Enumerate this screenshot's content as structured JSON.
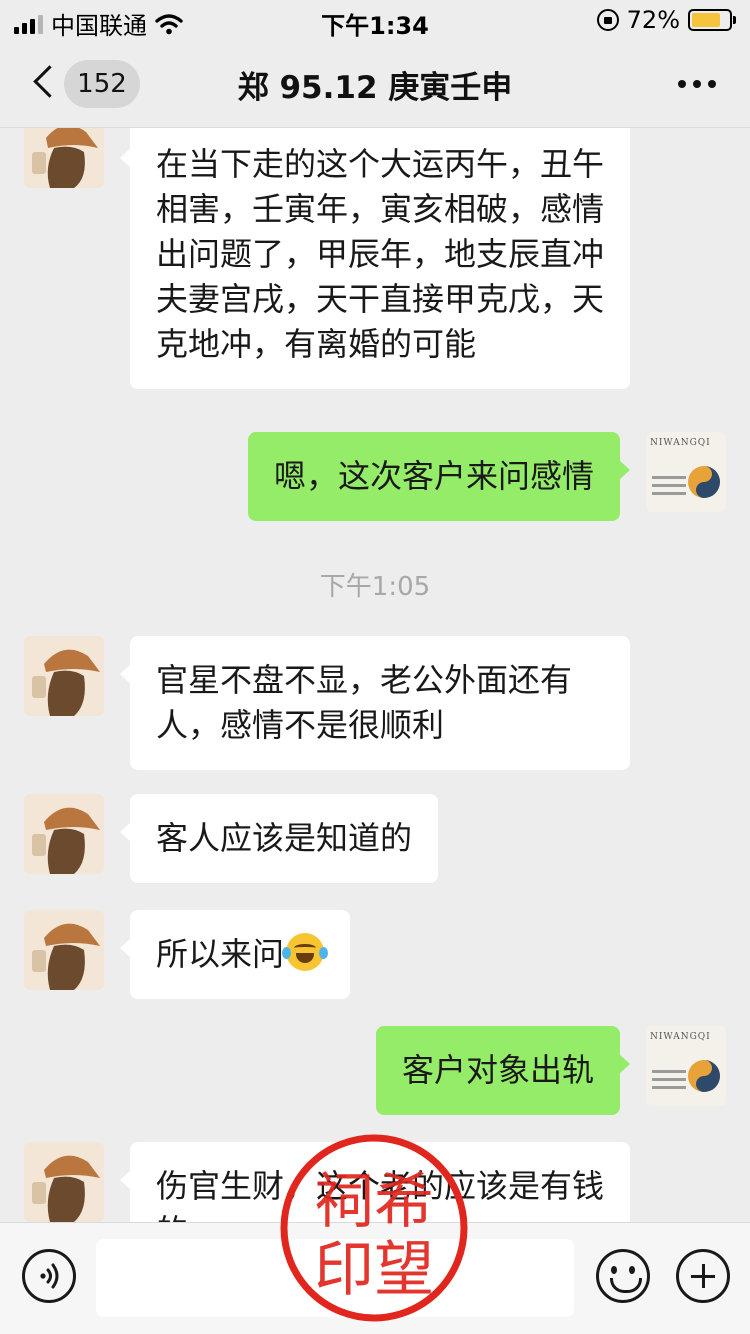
{
  "status_bar": {
    "carrier": "中国联通",
    "time": "下午1:34",
    "battery": "72%"
  },
  "nav": {
    "unread_count": "152",
    "title": "郑 95.12 庚寅壬申"
  },
  "messages": [
    {
      "sender": "other",
      "text": "在当下走的这个大运丙午，丑午相害，壬寅年，寅亥相破，感情出问题了，甲辰年，地支辰直冲夫妻宫戌，天干直接甲克戊，天克地冲，有离婚的可能"
    },
    {
      "sender": "self",
      "text": "嗯，这次客户来问感情"
    },
    {
      "timestamp": "下午1:05"
    },
    {
      "sender": "other",
      "text": "官星不盘不显，老公外面还有人，感情不是很顺利"
    },
    {
      "sender": "other",
      "text": "客人应该是知道的"
    },
    {
      "sender": "other",
      "text": "所以来问",
      "emoji": "tears-of-joy-emoji"
    },
    {
      "sender": "self",
      "text": "客户对象出轨"
    },
    {
      "sender": "other",
      "text": "伤官生财，这个老的应该是有钱的"
    }
  ],
  "self_avatar": {
    "brand_text": "NIWANGQI"
  },
  "stamp": {
    "text": "祠希印望",
    "color": "#e0261d"
  },
  "input": {
    "value": ""
  },
  "icons": {
    "back": "chevron-left-icon",
    "more": "more-dots-icon",
    "voice": "voice-icon",
    "emoji": "emoji-icon",
    "plus": "plus-icon"
  }
}
